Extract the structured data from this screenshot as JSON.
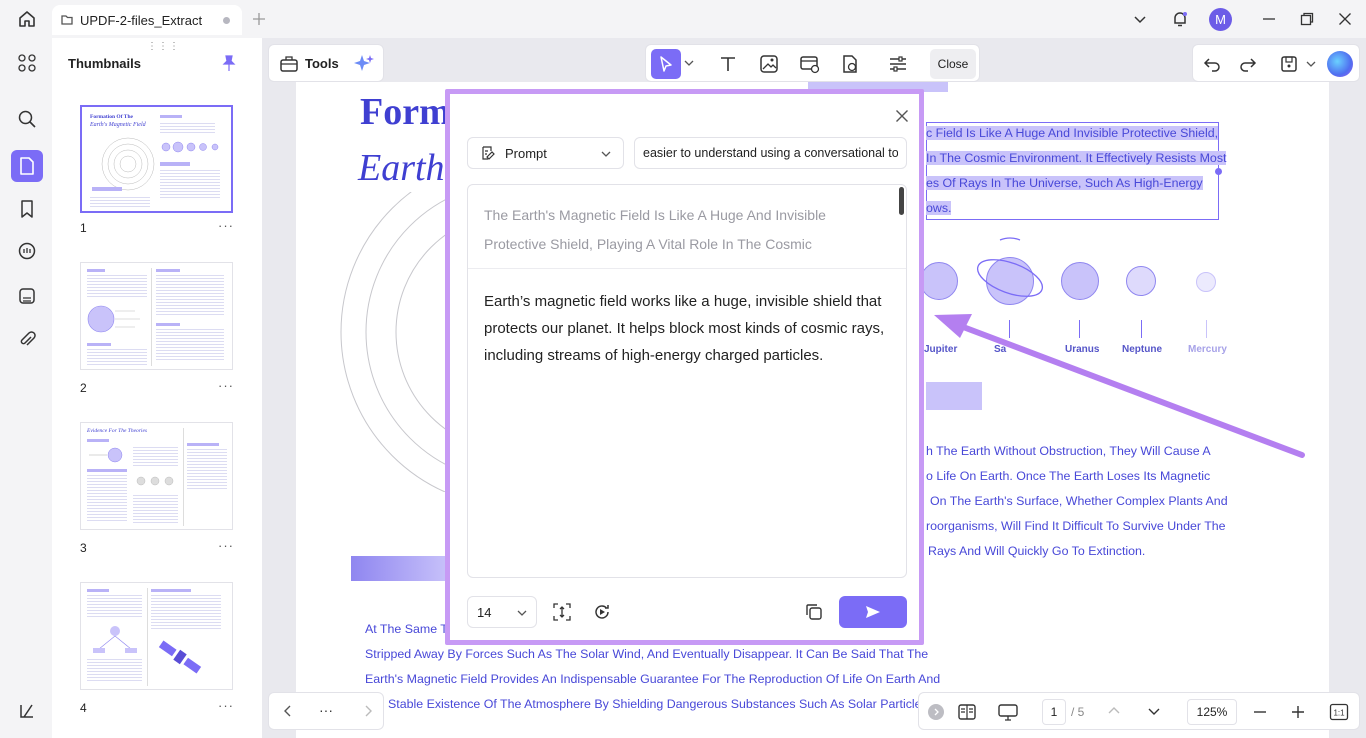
{
  "titlebar": {
    "tab_title": "UPDF-2-files_Extract",
    "avatar_letter": "M",
    "icons": [
      "home-icon",
      "file-tab-icon",
      "add-tab-icon",
      "chevron-down-icon",
      "bell-icon",
      "minimize-icon",
      "maximize-icon",
      "close-icon"
    ]
  },
  "rail": {
    "icons": [
      "apps-icon",
      "search-icon",
      "document-icon",
      "bookmark-icon",
      "comment-icon",
      "stamp-icon",
      "attachment-icon",
      "layers-icon"
    ]
  },
  "thumbnails": {
    "title": "Thumbnails",
    "pages": [
      {
        "number": "1",
        "more": "···",
        "heading1": "Formation Of The",
        "heading2": "Earth's Magnetic Field"
      },
      {
        "number": "2",
        "more": "···"
      },
      {
        "number": "3",
        "more": "···",
        "heading1": "Evidence For The Theories"
      },
      {
        "number": "4",
        "more": "···"
      }
    ]
  },
  "toolbar": {
    "tools_label": "Tools",
    "close_label": "Close"
  },
  "pdf": {
    "title_line1": "Form",
    "title_line2": "Earth",
    "selected_text": [
      "c Field Is Like A Huge And Invisible Protective Shield,",
      "In The Cosmic Environment. It Effectively Resists Most",
      "es Of Rays In The Universe, Such As High-Energy",
      "ows."
    ],
    "planets": [
      "Jupiter",
      "Sa",
      "Uranus",
      "Neptune",
      "Mercury"
    ],
    "body_right": [
      "h The Earth Without Obstruction, They Will Cause A",
      "o Life On Earth. Once The Earth Loses Its Magnetic",
      "On The Earth's Surface, Whether Complex Plants And",
      "roorganisms, Will Find It Difficult To Survive Under The",
      "Rays And Will Quickly Go To Extinction."
    ],
    "body_bottom": [
      "At The Same T",
      "Stripped Away By Forces Such As The Solar Wind, And Eventually Disappear. It Can Be Said That The",
      "Earth's Magnetic Field Provides An Indispensable Guarantee For The Reproduction Of Life On Earth And",
      "Stable Existence Of The Atmosphere By Shielding Dangerous Substances Such As Solar Particles."
    ]
  },
  "dialog": {
    "prompt_label": "Prompt",
    "prompt_value": "easier to understand using a conversational tone",
    "original_text": "The Earth's Magnetic Field Is Like A Huge And Invisible Protective Shield, Playing A Vital Role In The Cosmic",
    "result_text": "Earth’s magnetic field works like a huge, invisible shield that protects our planet. It helps block most kinds of cosmic rays, including streams of high-energy charged particles.",
    "font_size": "14"
  },
  "bottombar": {
    "more": "···",
    "page_current": "1",
    "page_total": "/ 5",
    "zoom": "125%"
  },
  "colors": {
    "accent": "#7b6cf6",
    "dialog_border": "#c79af5",
    "pdf_text": "#4848d8",
    "selection": "#c9c3fa"
  }
}
